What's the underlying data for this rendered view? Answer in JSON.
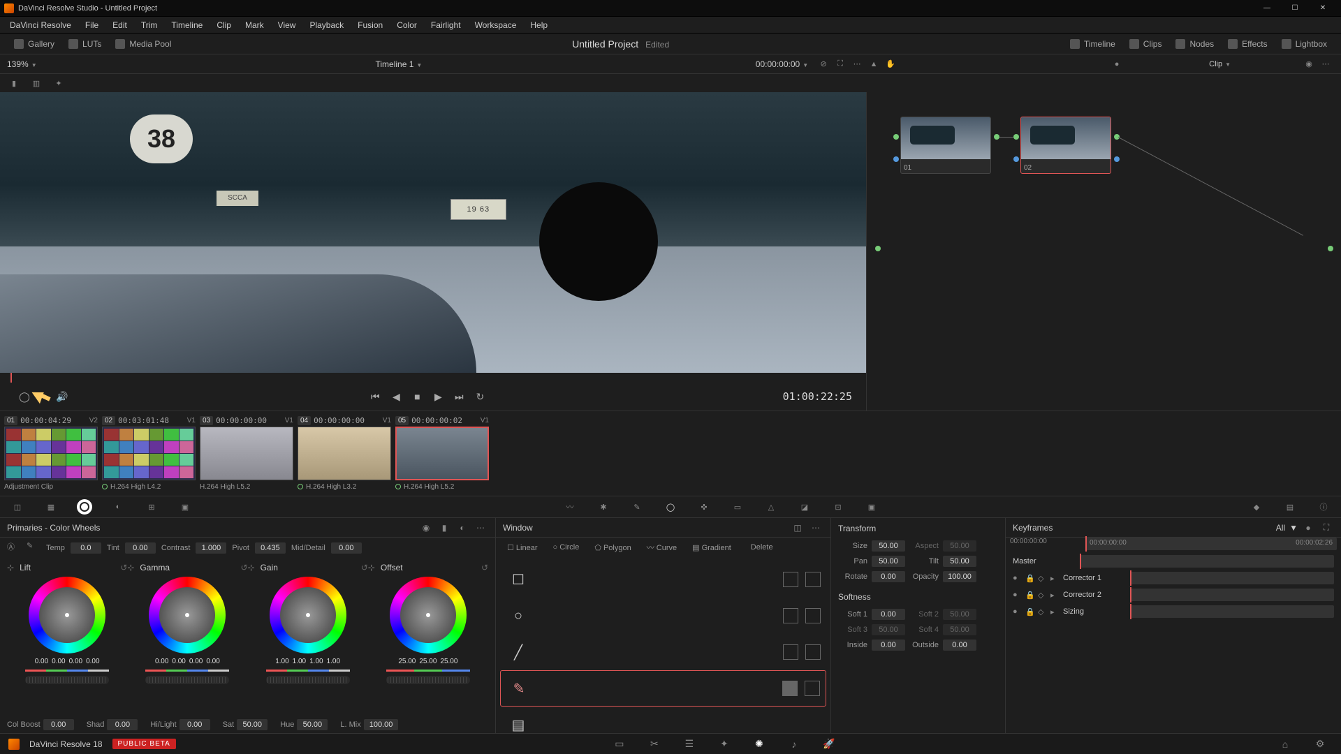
{
  "app": {
    "title": "DaVinci Resolve Studio - Untitled Project",
    "name": "DaVinci Resolve 18",
    "beta": "PUBLIC BETA"
  },
  "menu": [
    "DaVinci Resolve",
    "File",
    "Edit",
    "Trim",
    "Timeline",
    "Clip",
    "Mark",
    "View",
    "Playback",
    "Fusion",
    "Color",
    "Fairlight",
    "Workspace",
    "Help"
  ],
  "toolbar": {
    "gallery": "Gallery",
    "luts": "LUTs",
    "mediapool": "Media Pool",
    "project": "Untitled Project",
    "edited": "Edited",
    "timeline": "Timeline",
    "clips": "Clips",
    "nodes": "Nodes",
    "effects": "Effects",
    "lightbox": "Lightbox"
  },
  "subbar": {
    "zoom": "139%",
    "timeline": "Timeline 1",
    "timecode": "00:00:00:00",
    "clip": "Clip"
  },
  "viewer": {
    "car_number": "38",
    "plate": "19 63",
    "badge": "SCCA",
    "timecode": "01:00:22:25"
  },
  "nodes": [
    {
      "num": "01"
    },
    {
      "num": "02"
    }
  ],
  "clips": [
    {
      "num": "01",
      "tc": "00:00:04:29",
      "track": "V2",
      "label": "Adjustment Clip",
      "thumb": "grid"
    },
    {
      "num": "02",
      "tc": "00:03:01:48",
      "track": "V1",
      "label": "H.264 High L4.2",
      "thumb": "grid",
      "dot": true
    },
    {
      "num": "03",
      "tc": "00:00:00:00",
      "track": "V1",
      "label": "H.264 High L5.2",
      "thumb": "men"
    },
    {
      "num": "04",
      "tc": "00:00:00:00",
      "track": "V1",
      "label": "H.264 High L3.2",
      "thumb": "van",
      "dot": true
    },
    {
      "num": "05",
      "tc": "00:00:00:02",
      "track": "V1",
      "label": "H.264 High L5.2",
      "thumb": "car",
      "dot": true,
      "selected": true
    }
  ],
  "primaries": {
    "title": "Primaries - Color Wheels",
    "adjust": {
      "temp_l": "Temp",
      "temp": "0.0",
      "tint_l": "Tint",
      "tint": "0.00",
      "contrast_l": "Contrast",
      "contrast": "1.000",
      "pivot_l": "Pivot",
      "pivot": "0.435",
      "mid_l": "Mid/Detail",
      "mid": "0.00"
    },
    "wheels": [
      {
        "name": "Lift",
        "vals": [
          "0.00",
          "0.00",
          "0.00",
          "0.00"
        ]
      },
      {
        "name": "Gamma",
        "vals": [
          "0.00",
          "0.00",
          "0.00",
          "0.00"
        ]
      },
      {
        "name": "Gain",
        "vals": [
          "1.00",
          "1.00",
          "1.00",
          "1.00"
        ]
      },
      {
        "name": "Offset",
        "vals": [
          "25.00",
          "25.00",
          "25.00"
        ]
      }
    ],
    "row2": {
      "colboost_l": "Col Boost",
      "colboost": "0.00",
      "shad_l": "Shad",
      "shad": "0.00",
      "hilight_l": "Hi/Light",
      "hilight": "0.00",
      "sat_l": "Sat",
      "sat": "50.00",
      "hue_l": "Hue",
      "hue": "50.00",
      "lmix_l": "L. Mix",
      "lmix": "100.00"
    }
  },
  "window": {
    "title": "Window",
    "shapes": {
      "linear": "Linear",
      "circle": "Circle",
      "polygon": "Polygon",
      "curve": "Curve",
      "gradient": "Gradient",
      "delete": "Delete"
    }
  },
  "transform": {
    "title": "Transform",
    "softness_title": "Softness",
    "size_l": "Size",
    "size": "50.00",
    "aspect_l": "Aspect",
    "aspect": "50.00",
    "pan_l": "Pan",
    "pan": "50.00",
    "tilt_l": "Tilt",
    "tilt": "50.00",
    "rotate_l": "Rotate",
    "rotate": "0.00",
    "opacity_l": "Opacity",
    "opacity": "100.00",
    "soft1_l": "Soft 1",
    "soft1": "0.00",
    "soft2_l": "Soft 2",
    "soft2": "50.00",
    "soft3_l": "Soft 3",
    "soft3": "50.00",
    "soft4_l": "Soft 4",
    "soft4": "50.00",
    "inside_l": "Inside",
    "inside": "0.00",
    "outside_l": "Outside",
    "outside": "0.00"
  },
  "keyframes": {
    "title": "Keyframes",
    "all": "All",
    "tc_start": "00:00:00:00",
    "tc_cur": "00:00:00:00",
    "tc_end": "00:00:02:26",
    "rows": [
      "Master",
      "Corrector 1",
      "Corrector 2",
      "Sizing"
    ]
  }
}
